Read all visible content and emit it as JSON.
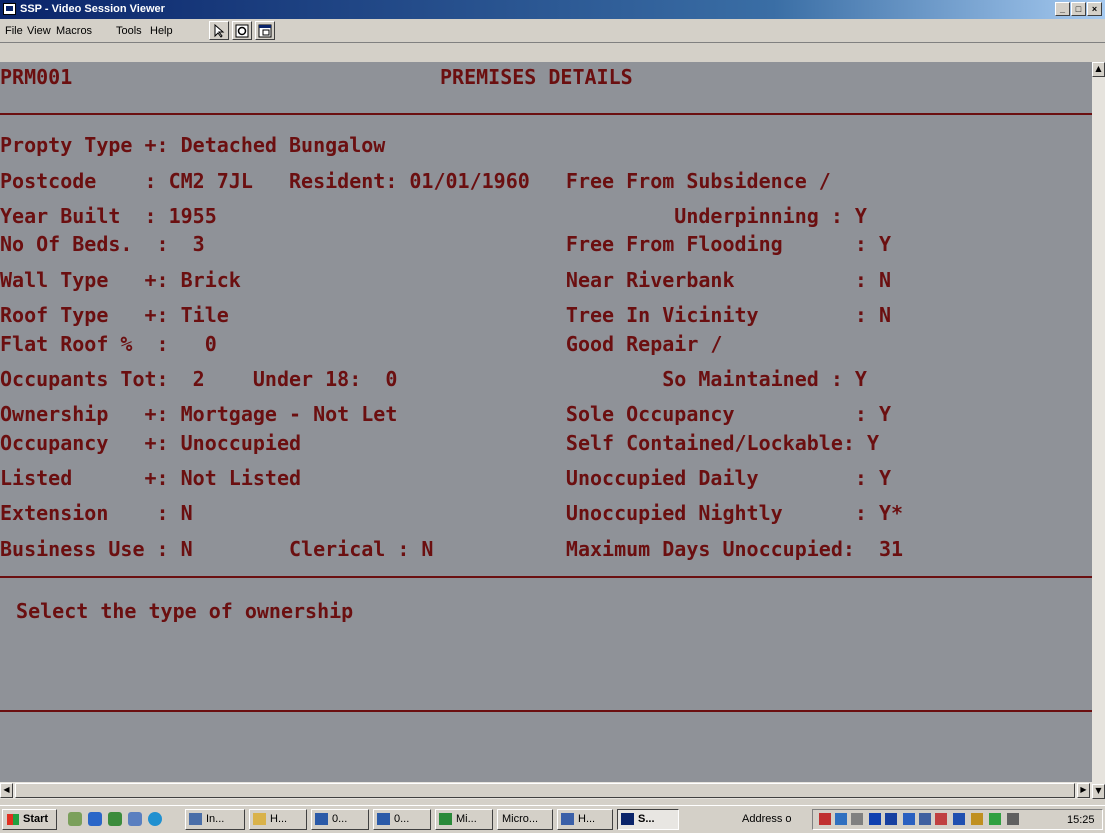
{
  "window": {
    "title": "SSP - Video Session Viewer"
  },
  "menu": [
    "File",
    "View",
    "Macros",
    "Tools",
    "Help"
  ],
  "screen": {
    "id": "PRM001",
    "title": "PREMISES DETAILS",
    "rows": [
      "Propty Type +: Detached Bungalow",
      "Postcode    : CM2 7JL   Resident: 01/01/1960   Free From Subsidence /",
      "Year Built  : 1955                                      Underpinning : Y",
      "No Of Beds.  :  3                              Free From Flooding      : Y",
      "Wall Type   +: Brick                           Near Riverbank          : N",
      "Roof Type   +: Tile                            Tree In Vicinity        : N",
      "Flat Roof %  :   0                             Good Repair /",
      "Occupants Tot:  2    Under 18:  0                      So Maintained : Y",
      "Ownership   +: Mortgage - Not Let              Sole Occupancy          : Y",
      "Occupancy   +: Unoccupied                      Self Contained/Lockable: Y",
      "Listed      +: Not Listed                      Unoccupied Daily        : Y",
      "Extension    : N                               Unoccupied Nightly      : Y*",
      "Business Use : N        Clerical : N           Maximum Days Unoccupied:  31"
    ],
    "message": " Select the type of ownership"
  },
  "taskbar": {
    "start": "Start",
    "tasks": [
      "In...",
      "H...",
      "0...",
      "0...",
      "Mi...",
      "Micro...",
      "H...",
      "S..."
    ],
    "address": "Address",
    "address_suffix": "o",
    "clock": "15:25"
  }
}
